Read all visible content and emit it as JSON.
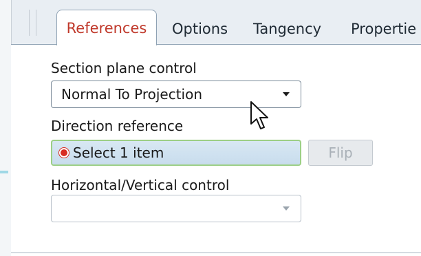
{
  "tabs": {
    "references": "References",
    "options": "Options",
    "tangency": "Tangency",
    "properties": "Propertie"
  },
  "section_plane": {
    "label": "Section plane control",
    "value": "Normal To Projection"
  },
  "direction": {
    "label": "Direction reference",
    "collector_value": "Select 1 item",
    "flip_label": "Flip"
  },
  "hv_control": {
    "label": "Horizontal/Vertical control",
    "value": ""
  },
  "colors": {
    "active_tab_text": "#c0392b",
    "required_dot": "#d72b22",
    "collector_border": "#9ccf86",
    "collector_fill": "#d8e8f3"
  },
  "icons": {
    "collector_status": "required-dot-icon",
    "cursor": "mouse-pointer-icon"
  }
}
